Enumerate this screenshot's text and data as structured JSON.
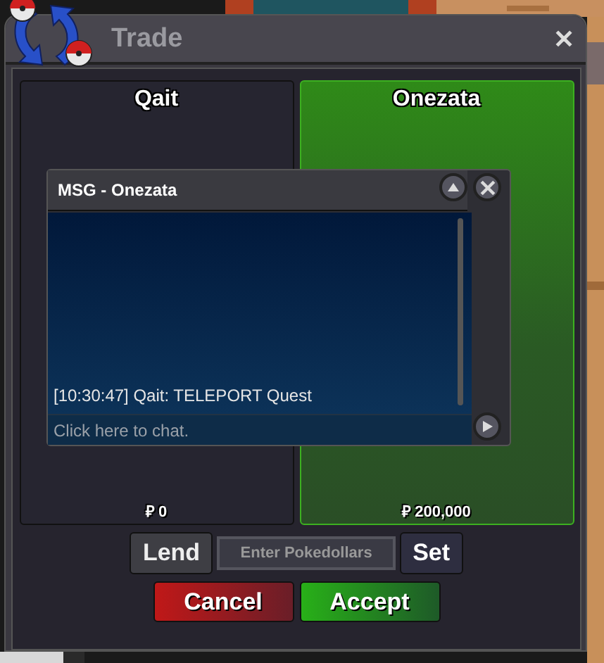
{
  "window": {
    "title": "Trade",
    "close": "✕"
  },
  "panels": [
    {
      "name": "Qait",
      "amount": "₽ 0",
      "accepted": false
    },
    {
      "name": "Onezata",
      "amount": "₽ 200,000",
      "accepted": true
    }
  ],
  "chat": {
    "title": "MSG - Onezata",
    "messages": [
      "[10:30:47] Qait: TELEPORT Quest"
    ],
    "placeholder": "Click here to chat."
  },
  "money": {
    "lend": "Lend",
    "placeholder": "Enter Pokedollars",
    "set": "Set"
  },
  "buttons": [
    {
      "label": "Cancel",
      "kind": "cancel"
    },
    {
      "label": "Accept",
      "kind": "accept"
    }
  ]
}
